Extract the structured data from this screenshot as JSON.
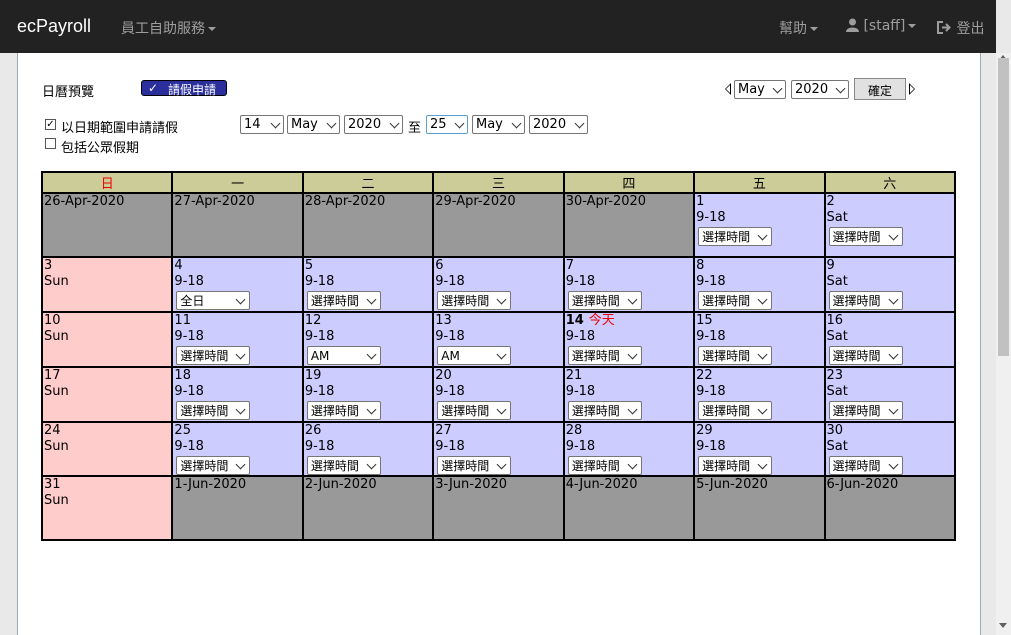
{
  "navbar": {
    "brand": "ecPayroll",
    "menu_self_service": "員工自助服務",
    "menu_help": "幫助",
    "menu_user": "[staff]",
    "menu_logout": "登出"
  },
  "toolbar": {
    "title": "日曆預覽",
    "leave_button": "請假申請",
    "nav_month": "May",
    "nav_year": "2020",
    "confirm_button": "確定"
  },
  "range": {
    "use_range_label": "以日期範圍申請請假",
    "use_range_checked": true,
    "include_holidays_label": "包括公眾假期",
    "include_holidays_checked": false,
    "from_day": "14",
    "from_month": "May",
    "from_year": "2020",
    "to_label": "至",
    "to_day": "25",
    "to_month": "May",
    "to_year": "2020"
  },
  "calendar": {
    "weekdays": [
      "日",
      "一",
      "二",
      "三",
      "四",
      "五",
      "六"
    ],
    "weeks": [
      [
        {
          "type": "other",
          "lines": [
            "26-Apr-2020"
          ]
        },
        {
          "type": "other",
          "lines": [
            "27-Apr-2020"
          ]
        },
        {
          "type": "other",
          "lines": [
            "28-Apr-2020"
          ]
        },
        {
          "type": "other",
          "lines": [
            "29-Apr-2020"
          ]
        },
        {
          "type": "other",
          "lines": [
            "30-Apr-2020"
          ]
        },
        {
          "type": "work",
          "lines": [
            "1",
            "9-18"
          ],
          "select": "選擇時間"
        },
        {
          "type": "work",
          "lines": [
            "2",
            "Sat"
          ],
          "select": "選擇時間"
        }
      ],
      [
        {
          "type": "sun",
          "lines": [
            "3",
            "Sun"
          ]
        },
        {
          "type": "work",
          "lines": [
            "4",
            "9-18"
          ],
          "select": "全日"
        },
        {
          "type": "work",
          "lines": [
            "5",
            "9-18"
          ],
          "select": "選擇時間"
        },
        {
          "type": "work",
          "lines": [
            "6",
            "9-18"
          ],
          "select": "選擇時間"
        },
        {
          "type": "work",
          "lines": [
            "7",
            "9-18"
          ],
          "select": "選擇時間"
        },
        {
          "type": "work",
          "lines": [
            "8",
            "9-18"
          ],
          "select": "選擇時間"
        },
        {
          "type": "work",
          "lines": [
            "9",
            "Sat"
          ],
          "select": "選擇時間"
        }
      ],
      [
        {
          "type": "sun",
          "lines": [
            "10",
            "Sun"
          ]
        },
        {
          "type": "work",
          "lines": [
            "11",
            "9-18"
          ],
          "select": "選擇時間"
        },
        {
          "type": "work",
          "lines": [
            "12",
            "9-18"
          ],
          "select": "AM"
        },
        {
          "type": "work",
          "lines": [
            "13",
            "9-18"
          ],
          "select": "AM"
        },
        {
          "type": "work",
          "lines": [
            "14",
            "9-18"
          ],
          "select": "選擇時間",
          "today": "今天"
        },
        {
          "type": "work",
          "lines": [
            "15",
            "9-18"
          ],
          "select": "選擇時間"
        },
        {
          "type": "work",
          "lines": [
            "16",
            "Sat"
          ],
          "select": "選擇時間"
        }
      ],
      [
        {
          "type": "sun",
          "lines": [
            "17",
            "Sun"
          ]
        },
        {
          "type": "work",
          "lines": [
            "18",
            "9-18"
          ],
          "select": "選擇時間"
        },
        {
          "type": "work",
          "lines": [
            "19",
            "9-18"
          ],
          "select": "選擇時間"
        },
        {
          "type": "work",
          "lines": [
            "20",
            "9-18"
          ],
          "select": "選擇時間"
        },
        {
          "type": "work",
          "lines": [
            "21",
            "9-18"
          ],
          "select": "選擇時間"
        },
        {
          "type": "work",
          "lines": [
            "22",
            "9-18"
          ],
          "select": "選擇時間"
        },
        {
          "type": "work",
          "lines": [
            "23",
            "Sat"
          ],
          "select": "選擇時間"
        }
      ],
      [
        {
          "type": "sun",
          "lines": [
            "24",
            "Sun"
          ]
        },
        {
          "type": "work",
          "lines": [
            "25",
            "9-18"
          ],
          "select": "選擇時間"
        },
        {
          "type": "work",
          "lines": [
            "26",
            "9-18"
          ],
          "select": "選擇時間"
        },
        {
          "type": "work",
          "lines": [
            "27",
            "9-18"
          ],
          "select": "選擇時間"
        },
        {
          "type": "work",
          "lines": [
            "28",
            "9-18"
          ],
          "select": "選擇時間"
        },
        {
          "type": "work",
          "lines": [
            "29",
            "9-18"
          ],
          "select": "選擇時間"
        },
        {
          "type": "work",
          "lines": [
            "30",
            "Sat"
          ],
          "select": "選擇時間"
        }
      ],
      [
        {
          "type": "sun",
          "lines": [
            "31",
            "Sun"
          ]
        },
        {
          "type": "other",
          "lines": [
            "1-Jun-2020"
          ]
        },
        {
          "type": "other",
          "lines": [
            "2-Jun-2020"
          ]
        },
        {
          "type": "other",
          "lines": [
            "3-Jun-2020"
          ]
        },
        {
          "type": "other",
          "lines": [
            "4-Jun-2020"
          ]
        },
        {
          "type": "other",
          "lines": [
            "5-Jun-2020"
          ]
        },
        {
          "type": "other",
          "lines": [
            "6-Jun-2020"
          ]
        }
      ]
    ]
  },
  "colors": {
    "navbar_bg": "#222222",
    "header_bg": "#cccc99",
    "workday_bg": "#ccccff",
    "sunday_bg": "#ffcccc",
    "other_month_bg": "#999999",
    "today_text": "#ee0000",
    "leave_button_bg": "#2a2f9b"
  },
  "icons": {
    "user": "user-icon",
    "logout": "logout-icon",
    "prev": "triangle-left-icon",
    "next": "triangle-right-icon",
    "check": "check-icon"
  }
}
